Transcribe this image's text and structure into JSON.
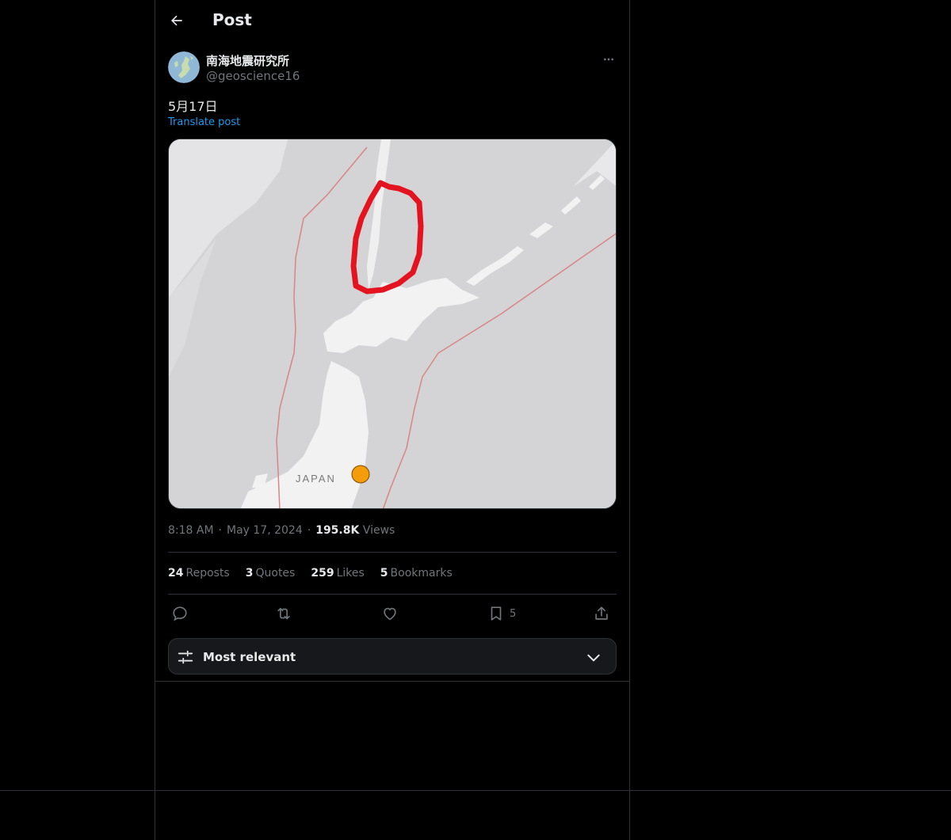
{
  "header": {
    "title": "Post"
  },
  "author": {
    "display_name": "南海地震研究所",
    "handle": "@geoscience16"
  },
  "post": {
    "text": "5月17日",
    "translate_label": "Translate post",
    "image": {
      "map_label": "JAPAN",
      "marker_color": "#f59c0a",
      "annotation_color": "#e3141f"
    },
    "time": "8:18 AM",
    "date": "May 17, 2024",
    "views_count": "195.8K",
    "views_label": "Views",
    "separator": "·"
  },
  "stats": [
    {
      "count": "24",
      "label": "Reposts"
    },
    {
      "count": "3",
      "label": "Quotes"
    },
    {
      "count": "259",
      "label": "Likes"
    },
    {
      "count": "5",
      "label": "Bookmarks"
    }
  ],
  "actions": {
    "bookmark_count": "5"
  },
  "sort": {
    "label": "Most relevant"
  },
  "colors": {
    "background": "#000000",
    "text": "#e7e9ea",
    "secondary": "#71767b",
    "link": "#1d9bf0",
    "border": "#2f3336"
  }
}
